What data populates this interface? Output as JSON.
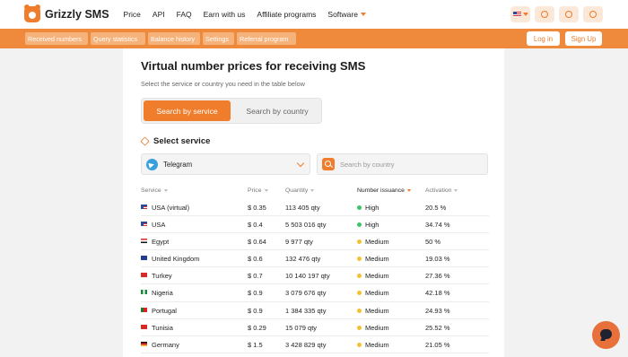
{
  "header": {
    "logo_text": "Grizzly SMS",
    "nav": [
      "Price",
      "API",
      "FAQ",
      "Earn with us",
      "Affiliate programs",
      "Software"
    ]
  },
  "subbar": {
    "tabs": [
      "Received numbers",
      "Query statistics",
      "Balance history",
      "Settings",
      "Referral program"
    ],
    "login": "Log in",
    "signup": "Sign Up"
  },
  "main": {
    "title": "Virtual number prices for receiving SMS",
    "subtitle": "Select the service or country you need in the table below",
    "toggle_active": "Search by service",
    "toggle_other": "Search by country",
    "section_label": "Select service",
    "service_selected": "Telegram",
    "country_placeholder": "Search by country"
  },
  "table": {
    "headers": [
      "Service",
      "Price",
      "Quantity",
      "Number issuance",
      "Activation"
    ],
    "rows": [
      {
        "country": "USA (virtual)",
        "price": "$ 0.35",
        "qty": "113 405 qty",
        "issuance": "High",
        "activation": "20.5 %",
        "flag": "us"
      },
      {
        "country": "USA",
        "price": "$ 0.4",
        "qty": "5 503 016 qty",
        "issuance": "High",
        "activation": "34.74 %",
        "flag": "us"
      },
      {
        "country": "Egypt",
        "price": "$ 0.64",
        "qty": "9 977 qty",
        "issuance": "Medium",
        "activation": "50 %",
        "flag": "eg"
      },
      {
        "country": "United Kingdom",
        "price": "$ 0.6",
        "qty": "132 476 qty",
        "issuance": "Medium",
        "activation": "19.03 %",
        "flag": "gb"
      },
      {
        "country": "Turkey",
        "price": "$ 0.7",
        "qty": "10 140 197 qty",
        "issuance": "Medium",
        "activation": "27.36 %",
        "flag": "tr"
      },
      {
        "country": "Nigeria",
        "price": "$ 0.9",
        "qty": "3 079 676 qty",
        "issuance": "Medium",
        "activation": "42.18 %",
        "flag": "ng"
      },
      {
        "country": "Portugal",
        "price": "$ 0.9",
        "qty": "1 384 335 qty",
        "issuance": "Medium",
        "activation": "24.93 %",
        "flag": "pt"
      },
      {
        "country": "Tunisia",
        "price": "$ 0.29",
        "qty": "15 079 qty",
        "issuance": "Medium",
        "activation": "25.52 %",
        "flag": "tn"
      },
      {
        "country": "Germany",
        "price": "$ 1.5",
        "qty": "3 428 829 qty",
        "issuance": "Medium",
        "activation": "21.05 %",
        "flag": "de"
      }
    ]
  },
  "colors": {
    "accent": "#ef7d2c",
    "high": "#3cc46a",
    "medium": "#f2c230"
  }
}
